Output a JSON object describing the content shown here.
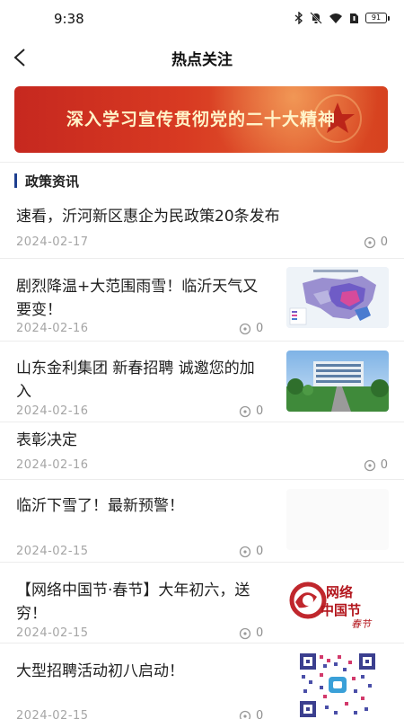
{
  "status_bar": {
    "time": "9:38",
    "battery": "91"
  },
  "nav": {
    "title": "热点关注"
  },
  "banner": {
    "text": "深入学习宣传贯彻党的二十大精神"
  },
  "section": {
    "title": "政策资讯"
  },
  "news": [
    {
      "title": "速看，沂河新区惠企为民政策20条发布",
      "date": "2024-02-17",
      "views": "0",
      "thumb": ""
    },
    {
      "title": "剧烈降温+大范围雨雪！临沂天气又要变！",
      "date": "2024-02-16",
      "views": "0",
      "thumb": "weather-map"
    },
    {
      "title": "山东金利集团  新春招聘  诚邀您的加入",
      "date": "2024-02-16",
      "views": "0",
      "thumb": "building-photo"
    },
    {
      "title": "表彰决定",
      "date": "2024-02-16",
      "views": "0",
      "thumb": ""
    },
    {
      "title": "临沂下雪了！最新预警！",
      "date": "2024-02-15",
      "views": "0",
      "thumb": "snow-photo"
    },
    {
      "title": "【网络中国节·春节】大年初六，送穷！",
      "date": "2024-02-15",
      "views": "0",
      "thumb": "festival-logo",
      "logo_text": {
        "main": "网络中国节",
        "sub": "春节"
      }
    },
    {
      "title": "大型招聘活动初八启动！",
      "date": "2024-02-15",
      "views": "0",
      "thumb": "qr-code"
    }
  ],
  "colors": {
    "accent": "#1e3f8f",
    "banner_red": "#d83a22",
    "date_gray": "#a5a5a5"
  }
}
